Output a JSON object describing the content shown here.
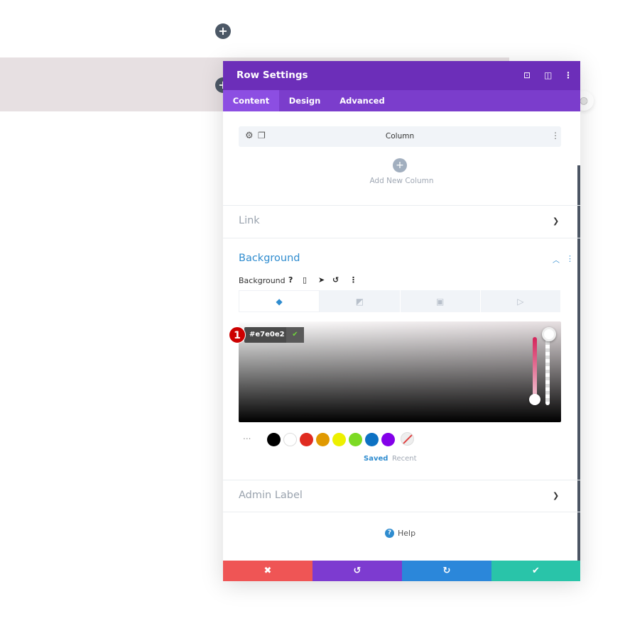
{
  "header": {
    "title": "Row Settings",
    "icons": [
      "screenshot-icon",
      "split-view-icon",
      "more-vertical-icon"
    ]
  },
  "tabs": [
    {
      "label": "Content",
      "active": true
    },
    {
      "label": "Design"
    },
    {
      "label": "Advanced"
    }
  ],
  "column": {
    "label": "Column"
  },
  "add_column": {
    "label": "Add New Column"
  },
  "sections": {
    "link": "Link",
    "background": "Background",
    "admin_label": "Admin Label"
  },
  "background": {
    "label": "Background",
    "hex_value": "#e7e0e2",
    "badge": "1",
    "swatches": [
      "#000000",
      "#ffffff",
      "#e02b20",
      "#e09900",
      "#edf000",
      "#7cda24",
      "#0c71c3",
      "#8300e9"
    ],
    "swatch_tabs": {
      "saved": "Saved",
      "recent": "Recent"
    },
    "more": "..."
  },
  "help": {
    "label": "Help"
  },
  "footer": {
    "colors": {
      "cancel": "#ef5555",
      "undo": "#7d3bd0",
      "redo": "#2b87da",
      "save": "#29c4a9"
    }
  }
}
